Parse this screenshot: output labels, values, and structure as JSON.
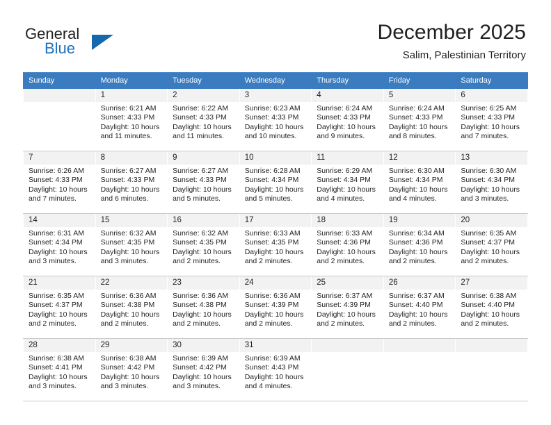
{
  "brand": {
    "name_top": "General",
    "name_bottom": "Blue",
    "accent_color": "#1567ae",
    "text_color": "#231f20",
    "triangle_icon": "triangle-logo-icon"
  },
  "header": {
    "month_title": "December 2025",
    "location": "Salim, Palestinian Territory"
  },
  "calendar": {
    "header_bg": "#3a7cbf",
    "daynum_bg": "#f2f2f2",
    "weekdays": [
      "Sunday",
      "Monday",
      "Tuesday",
      "Wednesday",
      "Thursday",
      "Friday",
      "Saturday"
    ],
    "weeks": [
      [
        {
          "day": "",
          "lines": []
        },
        {
          "day": "1",
          "lines": [
            "Sunrise: 6:21 AM",
            "Sunset: 4:33 PM",
            "Daylight: 10 hours",
            "and 11 minutes."
          ]
        },
        {
          "day": "2",
          "lines": [
            "Sunrise: 6:22 AM",
            "Sunset: 4:33 PM",
            "Daylight: 10 hours",
            "and 11 minutes."
          ]
        },
        {
          "day": "3",
          "lines": [
            "Sunrise: 6:23 AM",
            "Sunset: 4:33 PM",
            "Daylight: 10 hours",
            "and 10 minutes."
          ]
        },
        {
          "day": "4",
          "lines": [
            "Sunrise: 6:24 AM",
            "Sunset: 4:33 PM",
            "Daylight: 10 hours",
            "and 9 minutes."
          ]
        },
        {
          "day": "5",
          "lines": [
            "Sunrise: 6:24 AM",
            "Sunset: 4:33 PM",
            "Daylight: 10 hours",
            "and 8 minutes."
          ]
        },
        {
          "day": "6",
          "lines": [
            "Sunrise: 6:25 AM",
            "Sunset: 4:33 PM",
            "Daylight: 10 hours",
            "and 7 minutes."
          ]
        }
      ],
      [
        {
          "day": "7",
          "lines": [
            "Sunrise: 6:26 AM",
            "Sunset: 4:33 PM",
            "Daylight: 10 hours",
            "and 7 minutes."
          ]
        },
        {
          "day": "8",
          "lines": [
            "Sunrise: 6:27 AM",
            "Sunset: 4:33 PM",
            "Daylight: 10 hours",
            "and 6 minutes."
          ]
        },
        {
          "day": "9",
          "lines": [
            "Sunrise: 6:27 AM",
            "Sunset: 4:33 PM",
            "Daylight: 10 hours",
            "and 5 minutes."
          ]
        },
        {
          "day": "10",
          "lines": [
            "Sunrise: 6:28 AM",
            "Sunset: 4:34 PM",
            "Daylight: 10 hours",
            "and 5 minutes."
          ]
        },
        {
          "day": "11",
          "lines": [
            "Sunrise: 6:29 AM",
            "Sunset: 4:34 PM",
            "Daylight: 10 hours",
            "and 4 minutes."
          ]
        },
        {
          "day": "12",
          "lines": [
            "Sunrise: 6:30 AM",
            "Sunset: 4:34 PM",
            "Daylight: 10 hours",
            "and 4 minutes."
          ]
        },
        {
          "day": "13",
          "lines": [
            "Sunrise: 6:30 AM",
            "Sunset: 4:34 PM",
            "Daylight: 10 hours",
            "and 3 minutes."
          ]
        }
      ],
      [
        {
          "day": "14",
          "lines": [
            "Sunrise: 6:31 AM",
            "Sunset: 4:34 PM",
            "Daylight: 10 hours",
            "and 3 minutes."
          ]
        },
        {
          "day": "15",
          "lines": [
            "Sunrise: 6:32 AM",
            "Sunset: 4:35 PM",
            "Daylight: 10 hours",
            "and 3 minutes."
          ]
        },
        {
          "day": "16",
          "lines": [
            "Sunrise: 6:32 AM",
            "Sunset: 4:35 PM",
            "Daylight: 10 hours",
            "and 2 minutes."
          ]
        },
        {
          "day": "17",
          "lines": [
            "Sunrise: 6:33 AM",
            "Sunset: 4:35 PM",
            "Daylight: 10 hours",
            "and 2 minutes."
          ]
        },
        {
          "day": "18",
          "lines": [
            "Sunrise: 6:33 AM",
            "Sunset: 4:36 PM",
            "Daylight: 10 hours",
            "and 2 minutes."
          ]
        },
        {
          "day": "19",
          "lines": [
            "Sunrise: 6:34 AM",
            "Sunset: 4:36 PM",
            "Daylight: 10 hours",
            "and 2 minutes."
          ]
        },
        {
          "day": "20",
          "lines": [
            "Sunrise: 6:35 AM",
            "Sunset: 4:37 PM",
            "Daylight: 10 hours",
            "and 2 minutes."
          ]
        }
      ],
      [
        {
          "day": "21",
          "lines": [
            "Sunrise: 6:35 AM",
            "Sunset: 4:37 PM",
            "Daylight: 10 hours",
            "and 2 minutes."
          ]
        },
        {
          "day": "22",
          "lines": [
            "Sunrise: 6:36 AM",
            "Sunset: 4:38 PM",
            "Daylight: 10 hours",
            "and 2 minutes."
          ]
        },
        {
          "day": "23",
          "lines": [
            "Sunrise: 6:36 AM",
            "Sunset: 4:38 PM",
            "Daylight: 10 hours",
            "and 2 minutes."
          ]
        },
        {
          "day": "24",
          "lines": [
            "Sunrise: 6:36 AM",
            "Sunset: 4:39 PM",
            "Daylight: 10 hours",
            "and 2 minutes."
          ]
        },
        {
          "day": "25",
          "lines": [
            "Sunrise: 6:37 AM",
            "Sunset: 4:39 PM",
            "Daylight: 10 hours",
            "and 2 minutes."
          ]
        },
        {
          "day": "26",
          "lines": [
            "Sunrise: 6:37 AM",
            "Sunset: 4:40 PM",
            "Daylight: 10 hours",
            "and 2 minutes."
          ]
        },
        {
          "day": "27",
          "lines": [
            "Sunrise: 6:38 AM",
            "Sunset: 4:40 PM",
            "Daylight: 10 hours",
            "and 2 minutes."
          ]
        }
      ],
      [
        {
          "day": "28",
          "lines": [
            "Sunrise: 6:38 AM",
            "Sunset: 4:41 PM",
            "Daylight: 10 hours",
            "and 3 minutes."
          ]
        },
        {
          "day": "29",
          "lines": [
            "Sunrise: 6:38 AM",
            "Sunset: 4:42 PM",
            "Daylight: 10 hours",
            "and 3 minutes."
          ]
        },
        {
          "day": "30",
          "lines": [
            "Sunrise: 6:39 AM",
            "Sunset: 4:42 PM",
            "Daylight: 10 hours",
            "and 3 minutes."
          ]
        },
        {
          "day": "31",
          "lines": [
            "Sunrise: 6:39 AM",
            "Sunset: 4:43 PM",
            "Daylight: 10 hours",
            "and 4 minutes."
          ]
        },
        {
          "day": "",
          "lines": []
        },
        {
          "day": "",
          "lines": []
        },
        {
          "day": "",
          "lines": []
        }
      ]
    ]
  }
}
